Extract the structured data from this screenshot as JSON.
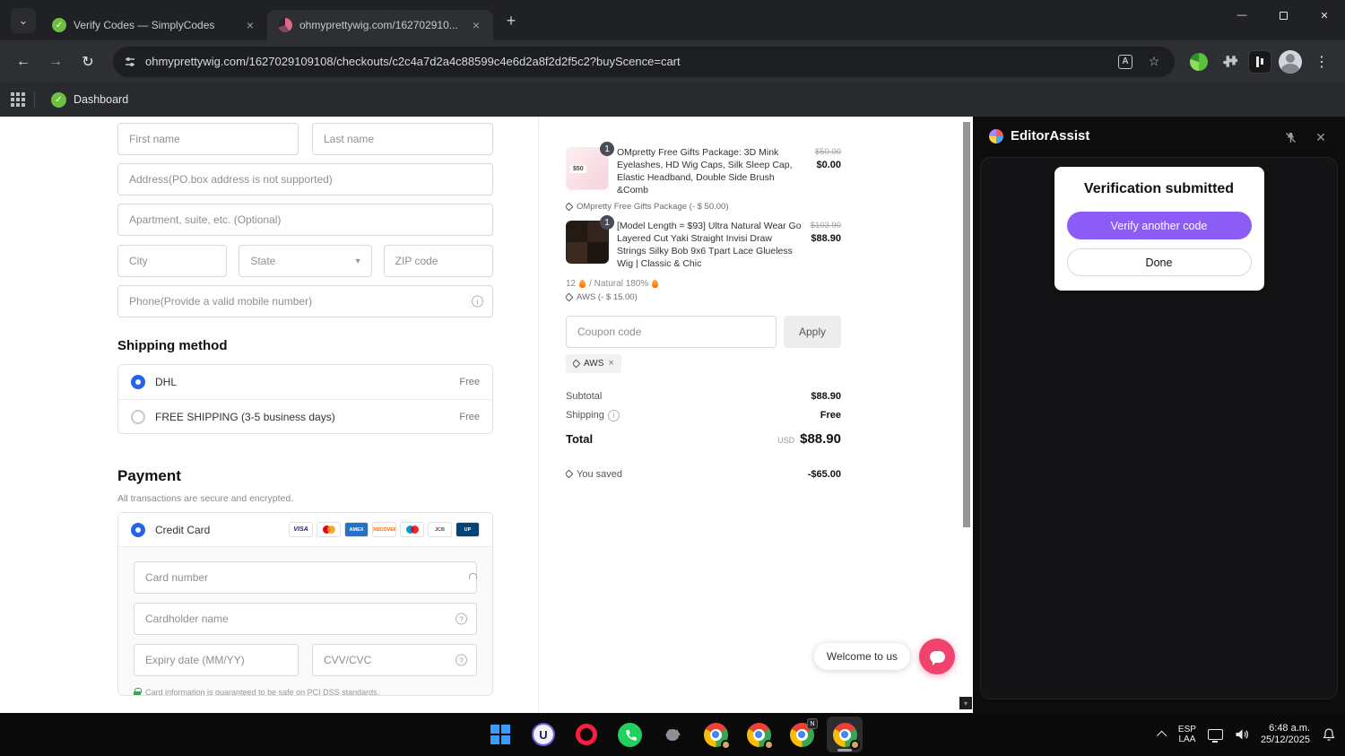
{
  "browser": {
    "tabs": [
      {
        "title": "Verify Codes — SimplyCodes"
      },
      {
        "title": "ohmyprettywig.com/162702910..."
      }
    ],
    "url": "ohmyprettywig.com/1627029109108/checkouts/c2c4a7d2a4c88599c4e6d2a8f2d2f5c2?buyScence=cart",
    "bookmarks": {
      "dashboard": "Dashboard"
    }
  },
  "glyphs": {
    "chevron_down": "⌄",
    "close_tab": "×",
    "new_tab": "+",
    "back": "←",
    "forward": "→",
    "reload": "↻",
    "translate": "A",
    "star": "☆",
    "menu": "⋮",
    "minimize": "—",
    "close_win": "✕",
    "caret": "▾",
    "info": "i",
    "help": "?",
    "check": "✓",
    "scroll_down": "▾",
    "pin_off": "⊘",
    "close_panel": "✕"
  },
  "checkout": {
    "form": {
      "first_name": "First name",
      "last_name": "Last name",
      "address": "Address(PO.box address is not supported)",
      "apartment": "Apartment, suite, etc. (Optional)",
      "city": "City",
      "state": "State",
      "zip": "ZIP code",
      "phone": "Phone(Provide a valid mobile number)"
    },
    "shipping": {
      "title": "Shipping method",
      "options": [
        {
          "label": "DHL",
          "price": "Free"
        },
        {
          "label": "FREE SHIPPING (3-5 business days)",
          "price": "Free"
        }
      ]
    },
    "payment": {
      "title": "Payment",
      "subtitle": "All transactions are secure and encrypted.",
      "method": "Credit Card",
      "brands": {
        "visa": "VISA",
        "amex": "AMEX",
        "discover": "DISCOVER",
        "jcb": "JCB",
        "unionpay": "UP"
      },
      "card_number": "Card number",
      "cardholder": "Cardholder name",
      "expiry": "Expiry date (MM/YY)",
      "cvv": "CVV/CVC",
      "pci": "Card information is guaranteed to be safe on PCI DSS standards."
    },
    "summary": {
      "items": [
        {
          "qty": "1",
          "thumb_text": "$50",
          "title": "OMpretty Free Gifts Package: 3D Mink Eyelashes, HD Wig Caps, Silk Sleep Cap, Elastic Headband, Double Side Brush &Comb",
          "old_price": "$50.00",
          "price": "$0.00",
          "tag": "OMpretty Free Gifts Package (- $ 50.00)"
        },
        {
          "qty": "1",
          "title": "[Model Length = $93] Ultra Natural Wear Go Layered Cut Yaki Straight Invisi Draw Strings Silky Bob 9x6 Tpart Lace Glueless Wig | Classic & Chic",
          "old_price": "$103.90",
          "price": "$88.90",
          "variant_a": "12",
          "variant_b": "/ Natural 180%",
          "tag": "AWS (- $ 15.00)"
        }
      ],
      "coupon_placeholder": "Coupon code",
      "apply": "Apply",
      "chip": "AWS",
      "subtotal_label": "Subtotal",
      "subtotal": "$88.90",
      "shipping_label": "Shipping",
      "shipping_value": "Free",
      "total_label": "Total",
      "currency": "USD",
      "total": "$88.90",
      "saved_label": "You saved",
      "saved": "-$65.00"
    },
    "chat": "Welcome to us"
  },
  "assist": {
    "title": "EditorAssist",
    "card_title": "Verification submitted",
    "verify_button": "Verify another code",
    "done_button": "Done"
  },
  "taskbar": {
    "u_label": "U",
    "n_badge": "N",
    "lang1": "ESP",
    "lang2": "LAA",
    "time": "6:48 a.m.",
    "date": "25/12/2025"
  }
}
